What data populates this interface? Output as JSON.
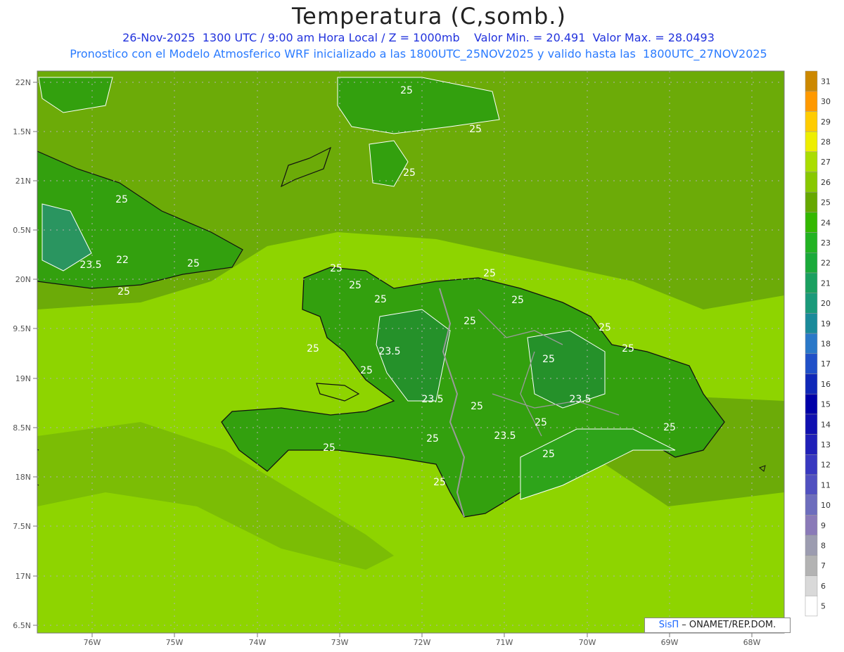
{
  "header": {
    "title": "Temperatura (C,somb.)",
    "line1": "26-Nov-2025  1300 UTC / 9:00 am Hora Local / Z = 1000mb    Valor Min. = 20.491  Valor Max. = 28.0493",
    "line2": "Pronostico con el Modelo Atmosferico WRF inicializado a las 1800UTC_25NOV2025 y valido hasta las  1800UTC_27NOV2025"
  },
  "axes": {
    "lat_labels": [
      "22N",
      "1.5N",
      "21N",
      "0.5N",
      "20N",
      "9.5N",
      "19N",
      "8.5N",
      "18N",
      "7.5N",
      "17N",
      "6.5N"
    ],
    "lon_labels": [
      "76W",
      "75W",
      "74W",
      "73W",
      "72W",
      "71W",
      "70W",
      "69W",
      "68W"
    ]
  },
  "legend": {
    "levels": [
      "5",
      "6",
      "7",
      "8",
      "9",
      "10",
      "11",
      "12",
      "13",
      "14",
      "15",
      "16",
      "17",
      "18",
      "19",
      "20",
      "21",
      "22",
      "23",
      "24",
      "25",
      "26",
      "27",
      "28",
      "29",
      "30",
      "31"
    ],
    "colors": [
      "#ffffff",
      "#d9d9d9",
      "#b3b3b3",
      "#9c9cb0",
      "#8a7ab8",
      "#6d6dbd",
      "#5050c0",
      "#3838c0",
      "#2020b8",
      "#1010b0",
      "#0000a8",
      "#1028b8",
      "#2050c8",
      "#2a78c8",
      "#1a8a9a",
      "#1a9a7a",
      "#1aa060",
      "#1aaa3a",
      "#22b322",
      "#33b800",
      "#66a800",
      "#88c800",
      "#aadd00",
      "#eeee00",
      "#ffcc00",
      "#ff9900",
      "#cc8800"
    ]
  },
  "contour_labels": [
    "25",
    "25",
    "25",
    "25",
    "25",
    "25",
    "25",
    "25",
    "23.5",
    "22",
    "25",
    "25",
    "25",
    "25",
    "23.5",
    "25",
    "25",
    "23.5",
    "25",
    "23.5",
    "25",
    "25",
    "23.5",
    "25",
    "25",
    "25",
    "25",
    "25",
    "25",
    "25"
  ],
  "credit": {
    "brand": "SisΠ",
    "text": " – ONAMET/REP.DOM."
  },
  "colors": {
    "sea": "#8ed400",
    "band": "#6cab08",
    "land": "#33a00e",
    "inner": "#25912a",
    "coast": "#111111",
    "border": "#9a9a9a",
    "contour": "#ffffff"
  }
}
